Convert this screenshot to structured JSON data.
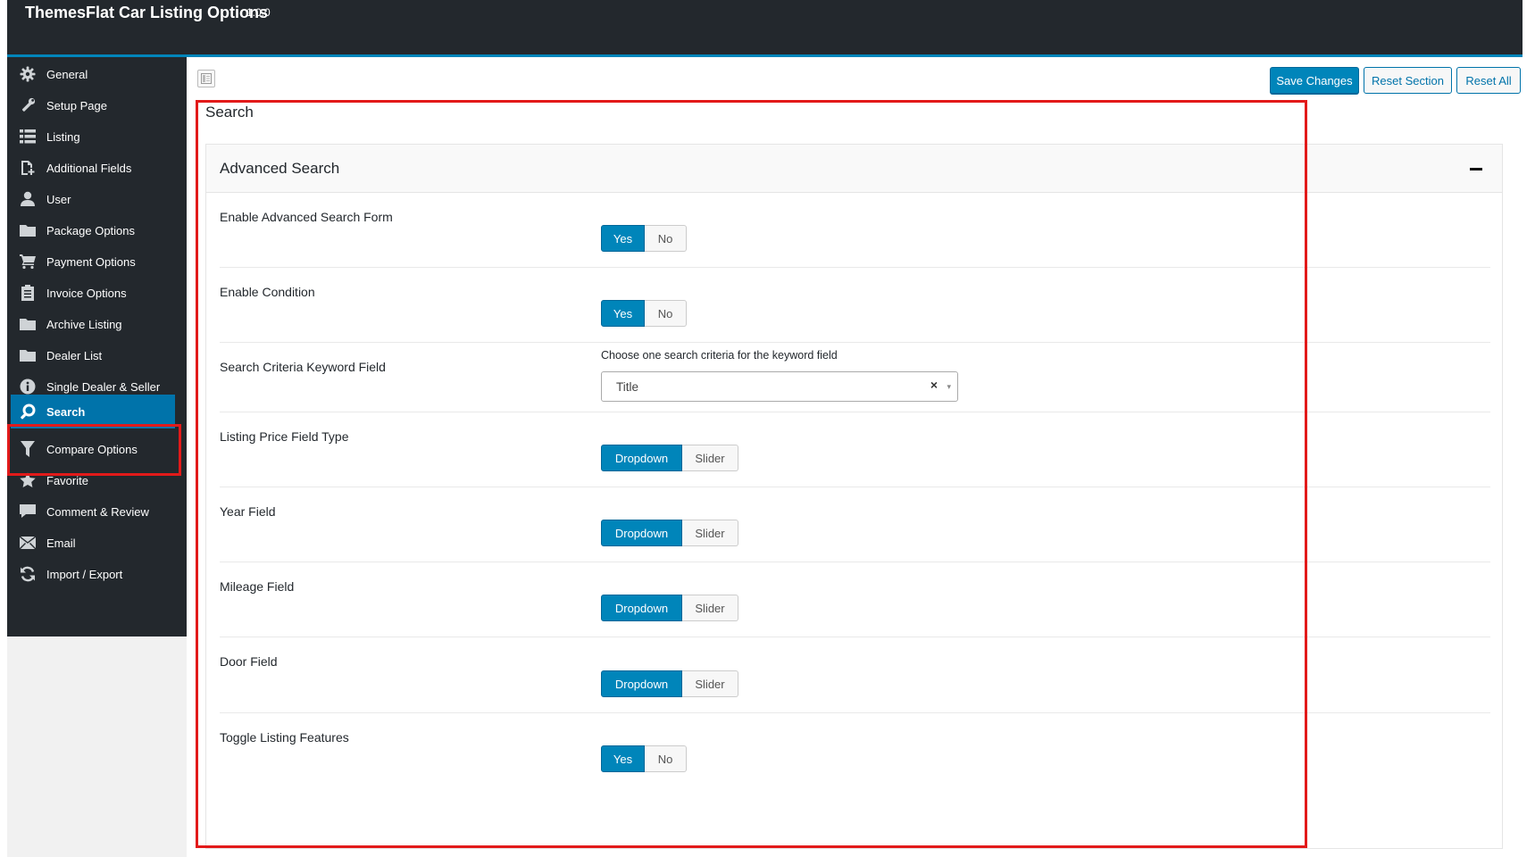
{
  "header": {
    "title": "ThemesFlat Car Listing Options",
    "version": "1.0.0"
  },
  "sidebar": {
    "items": [
      {
        "label": "General",
        "icon": "gear-icon"
      },
      {
        "label": "Setup Page",
        "icon": "wrench-icon"
      },
      {
        "label": "Listing",
        "icon": "list-icon"
      },
      {
        "label": "Additional Fields",
        "icon": "file-plus-icon"
      },
      {
        "label": "User",
        "icon": "user-icon"
      },
      {
        "label": "Package Options",
        "icon": "folder-icon"
      },
      {
        "label": "Payment Options",
        "icon": "cart-icon"
      },
      {
        "label": "Invoice Options",
        "icon": "clipboard-icon"
      },
      {
        "label": "Archive Listing",
        "icon": "folder-icon"
      },
      {
        "label": "Dealer List",
        "icon": "folder-icon"
      },
      {
        "label": "Single Dealer & Seller",
        "icon": "info-icon"
      },
      {
        "label": "Search",
        "icon": "search-icon",
        "active": true
      },
      {
        "label": "Compare Options",
        "icon": "funnel-icon"
      },
      {
        "label": "Favorite",
        "icon": "star-icon"
      },
      {
        "label": "Comment & Review",
        "icon": "comment-icon"
      },
      {
        "label": "Email",
        "icon": "envelope-icon"
      },
      {
        "label": "Import / Export",
        "icon": "refresh-icon"
      }
    ]
  },
  "toolbar": {
    "save_label": "Save Changes",
    "reset_section_label": "Reset Section",
    "reset_all_label": "Reset All"
  },
  "main": {
    "section_title": "Search",
    "panel": {
      "title": "Advanced Search",
      "fields": {
        "advanced_search": {
          "label": "Enable Advanced Search Form",
          "options": [
            "Yes",
            "No"
          ],
          "selected": "Yes"
        },
        "condition": {
          "label": "Enable Condition",
          "options": [
            "Yes",
            "No"
          ],
          "selected": "Yes"
        },
        "keyword": {
          "label": "Search Criteria Keyword Field",
          "description": "Choose one search criteria for the keyword field",
          "value": "Title",
          "clear": "×",
          "arrow": "▾"
        },
        "price": {
          "label": "Listing Price Field Type",
          "options": [
            "Dropdown",
            "Slider"
          ],
          "selected": "Dropdown"
        },
        "year": {
          "label": "Year Field",
          "options": [
            "Dropdown",
            "Slider"
          ],
          "selected": "Dropdown"
        },
        "mileage": {
          "label": "Mileage Field",
          "options": [
            "Dropdown",
            "Slider"
          ],
          "selected": "Dropdown"
        },
        "door": {
          "label": "Door Field",
          "options": [
            "Dropdown",
            "Slider"
          ],
          "selected": "Dropdown"
        },
        "toggle_features": {
          "label": "Toggle Listing Features",
          "options": [
            "Yes",
            "No"
          ],
          "selected": "Yes"
        }
      }
    }
  },
  "colors": {
    "accent": "#0085ba",
    "sidebar_bg": "#23282d",
    "active_bg": "#0073aa",
    "highlight": "#e21a1a"
  }
}
